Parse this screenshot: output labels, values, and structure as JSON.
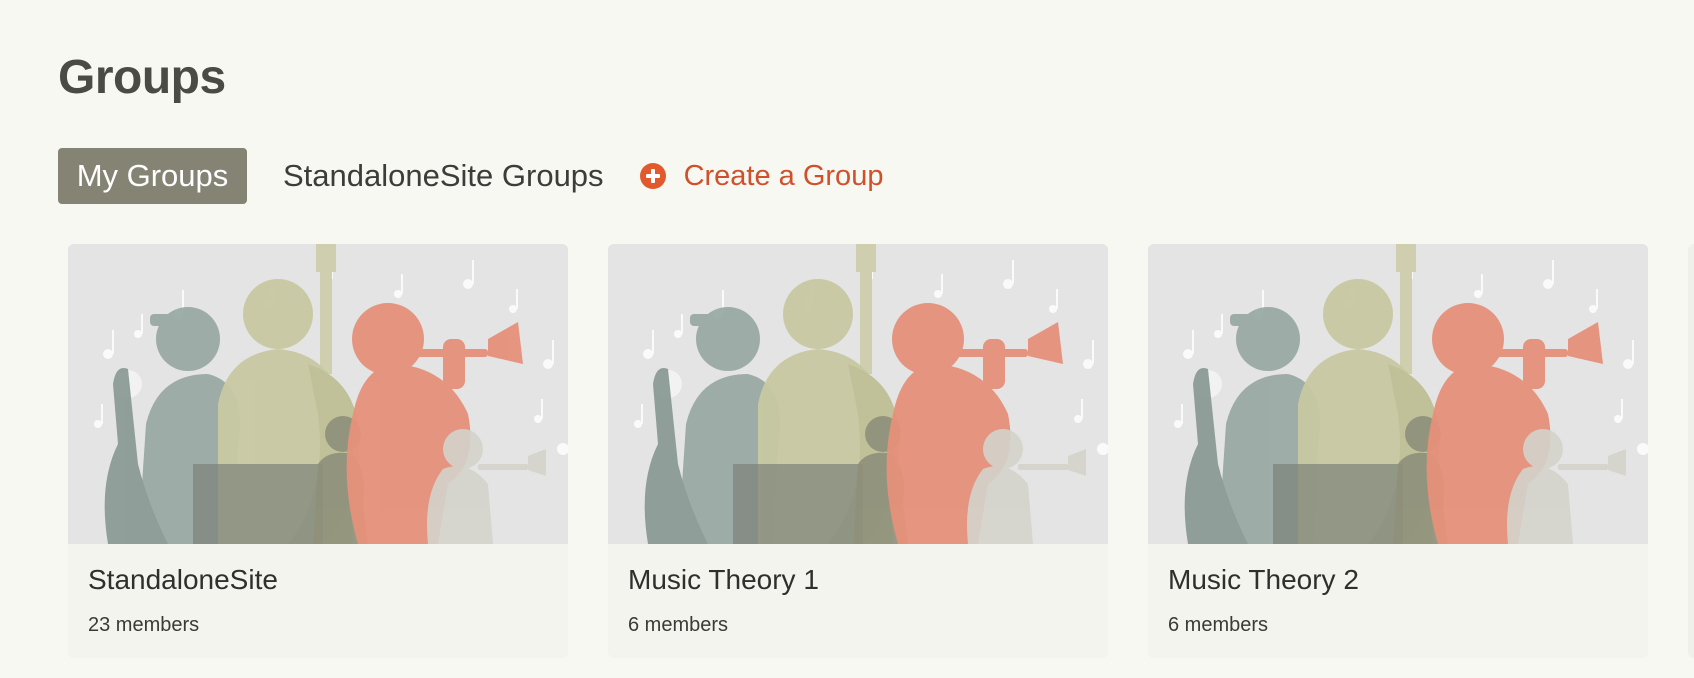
{
  "header": {
    "title": "Groups"
  },
  "tabs": {
    "my_groups": "My Groups",
    "site_groups": "StandaloneSite Groups",
    "create_group": "Create a Group"
  },
  "groups": [
    {
      "name": "StandaloneSite",
      "members": "23 members"
    },
    {
      "name": "Music Theory 1",
      "members": "6 members"
    },
    {
      "name": "Music Theory 2",
      "members": "6 members"
    }
  ],
  "colors": {
    "accent": "#d0502c",
    "active_tab": "#858374",
    "background": "#f8f8f3"
  }
}
